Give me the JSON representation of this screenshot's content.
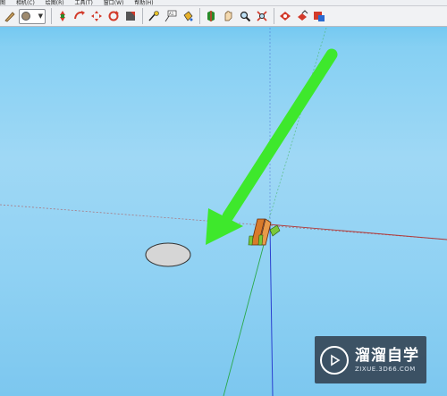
{
  "menubar": {
    "items": [
      "图",
      "相机(C)",
      "绘图(R)",
      "工具(T)",
      "窗口(W)",
      "帮助(H)"
    ]
  },
  "toolbar": {
    "style_dropdown": {
      "selected": "color-swatch"
    },
    "groups": [
      [
        "pencil-icon"
      ],
      [
        "move-icon",
        "rotate-icon",
        "reset-icon",
        "refresh-icon",
        "shape-icon"
      ],
      [
        "tape-measure-icon",
        "text-icon",
        "paint-bucket-icon"
      ],
      [
        "orbit-icon",
        "pan-icon",
        "zoom-icon",
        "zoom-extents-icon"
      ],
      [
        "warehouse-icon",
        "component-icon",
        "share-icon"
      ]
    ]
  },
  "watermark": {
    "title": "溜溜自学",
    "url": "ZIXUE.3D66.COM"
  },
  "colors": {
    "sky": "#9fd8f5",
    "arrow": "#3ee82c",
    "axis_red": "#b04a4a",
    "axis_green": "#2aa84a",
    "axis_blue": "#2a40d0"
  }
}
